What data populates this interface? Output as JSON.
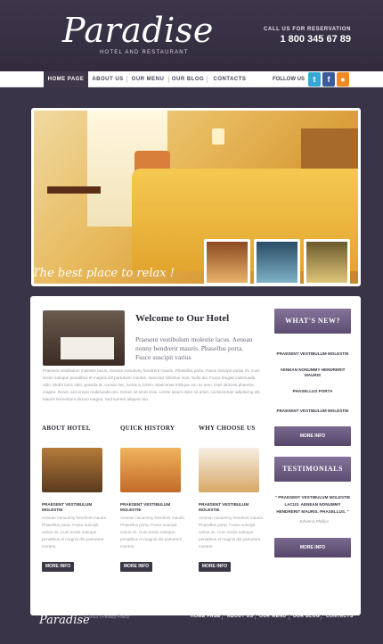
{
  "header": {
    "logo": "Paradise",
    "logo_sub": "HOTEL AND RESTAURANT",
    "call_label": "CALL US FOR RESERVATION",
    "phone": "1 800 345 67 89"
  },
  "nav": {
    "items": [
      "HOME PAGE",
      "ABOUT US",
      "OUR MENU",
      "OUR BLOG",
      "CONTACTS"
    ],
    "follow_label": "FOLLOW US"
  },
  "colors": {
    "twitter": "#35a9d6",
    "facebook": "#3b5b9a",
    "rss": "#ef8a23"
  },
  "slider": {
    "tagline": "The best place to relax !"
  },
  "welcome": {
    "title": "Welcome to Our Hotel",
    "lead": "Praesent vestibulum molestie lacus. Aenean nonny hendrerit mauris. Phasellus porta. Fusce suscipit varius",
    "body": "Praesent vestibulum molestie lacus. Aenean nonummy hendrerit mauris. Phasellus porta. Fusce suscipit varius mi. Cum sociis natoque penatibus et magnis dis parturient montes, nascetur ridiculus mus. Nulla dui. Fusce feugiat malesuada odio. Morbi nunc odio, gravida at, cursus nec, luctus a, lorem. Maecenas tristique orci ac sem. Duis ultricies pharetra magna. Donec accumsan malesuada orci. Donec sit amet eros. Lorem ipsum dolor sit amet, consectetuer adipiscing elit. Mauris fermentum dictum magna. Sed laoreet aliquam leo."
  },
  "columns": [
    {
      "title": "ABOUT HOTEL",
      "sub": "PRAESENT VESTIBULUM MOLESTIE",
      "text": "Aenean nonummy hendrerit mauris. Phasellus porta. Fusce suscipit varius mi. Cum sociis natoque penatibus et magnis dis parturient montes.",
      "btn": "MORE INFO"
    },
    {
      "title": "QUICK HISTORY",
      "sub": "PRAESENT VESTIBULUM MOLESTIE",
      "text": "Aenean nonummy hendrerit mauris. Phasellus porta. Fusce suscipit varius mi. Cum sociis natoque penatibus et magnis dis parturient montes.",
      "btn": "MORE INFO"
    },
    {
      "title": "WHY CHOOSE US",
      "sub": "PRAESENT VESTIBULUM MOLESTIE",
      "text": "Aenean nonummy hendrerit mauris. Phasellus porta. Fusce suscipit varius mi. Cum sociis natoque penatibus et magnis dis parturient montes.",
      "btn": "MORE INFO"
    }
  ],
  "sidebar": {
    "news_title": "WHAT'S NEW?",
    "news": [
      "PRAESENT VESTIBULUM MOLESTIE",
      "AENEAN NONUMMY HENDRERIT MAURIS",
      "PHASELLUS PORTA",
      "PRAESENT VESTIBULUM MOLESTIE"
    ],
    "news_btn": "MORE INFO",
    "testimonials_title": "TESTIMONIALS",
    "testimonial": "\" PRAESENT VESTIBULUM MOLESTIE LACUS. AENEAN NONUMMY HENDRERIT MAURIS. PHASELLUS. \"",
    "testimonial_author": "- Johanna Phillips",
    "testimonials_btn": "MORE INFO"
  },
  "footer": {
    "logo": "Paradise",
    "copy": "© 2013 | Privacy Policy",
    "nav": [
      "HOME PAGE",
      "ABOUT US",
      "OUR MENU",
      "OUR BLOG",
      "CONTACTS"
    ]
  }
}
